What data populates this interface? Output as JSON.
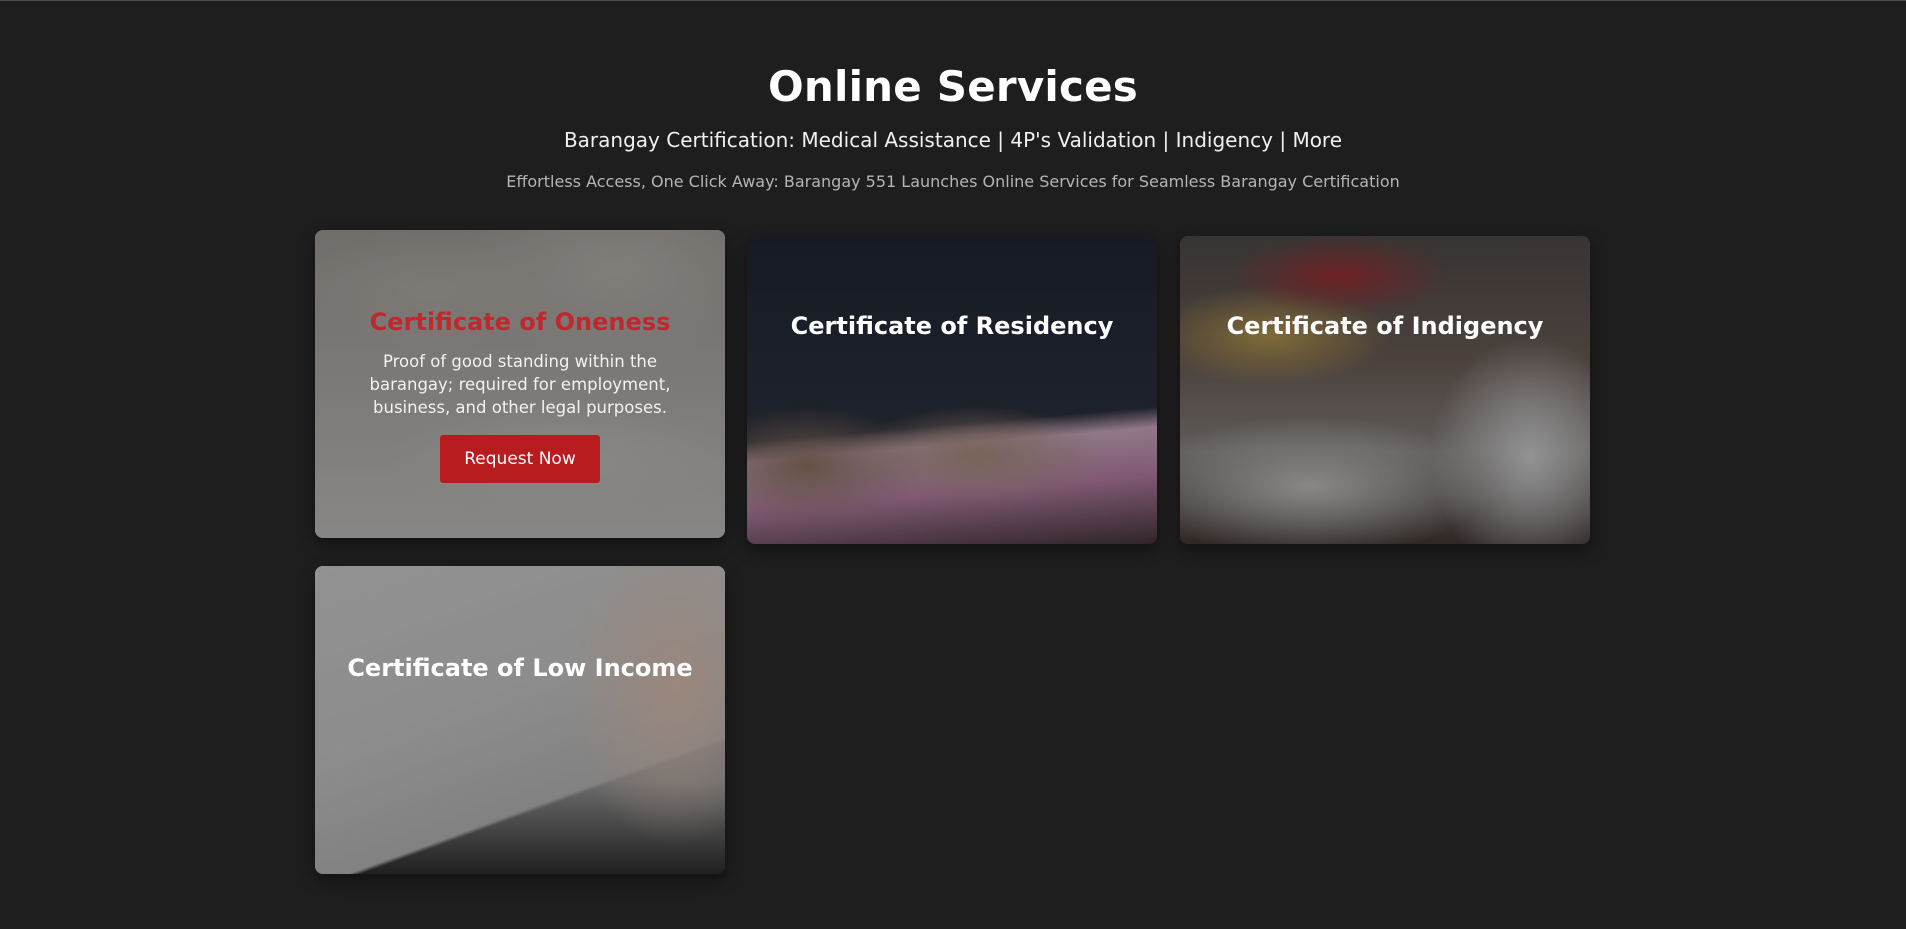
{
  "page": {
    "title": "Online Services",
    "subtitle": "Barangay Certification: Medical Assistance | 4P's Validation | Indigency | More",
    "tagline": "Effortless Access, One Click Away: Barangay 551 Launches Online Services for Seamless Barangay Certification"
  },
  "cards": [
    {
      "title": "Certificate of Oneness",
      "description": "Proof of good standing within the barangay; required for employment, business, and other legal purposes.",
      "button_label": "Request Now"
    },
    {
      "title": "Certificate of Residency"
    },
    {
      "title": "Certificate of Indigency"
    },
    {
      "title": "Certificate of Low Income"
    }
  ],
  "colors": {
    "background": "#1e1e1e",
    "accent": "#b91c1f",
    "accent_text": "#c1272d"
  }
}
